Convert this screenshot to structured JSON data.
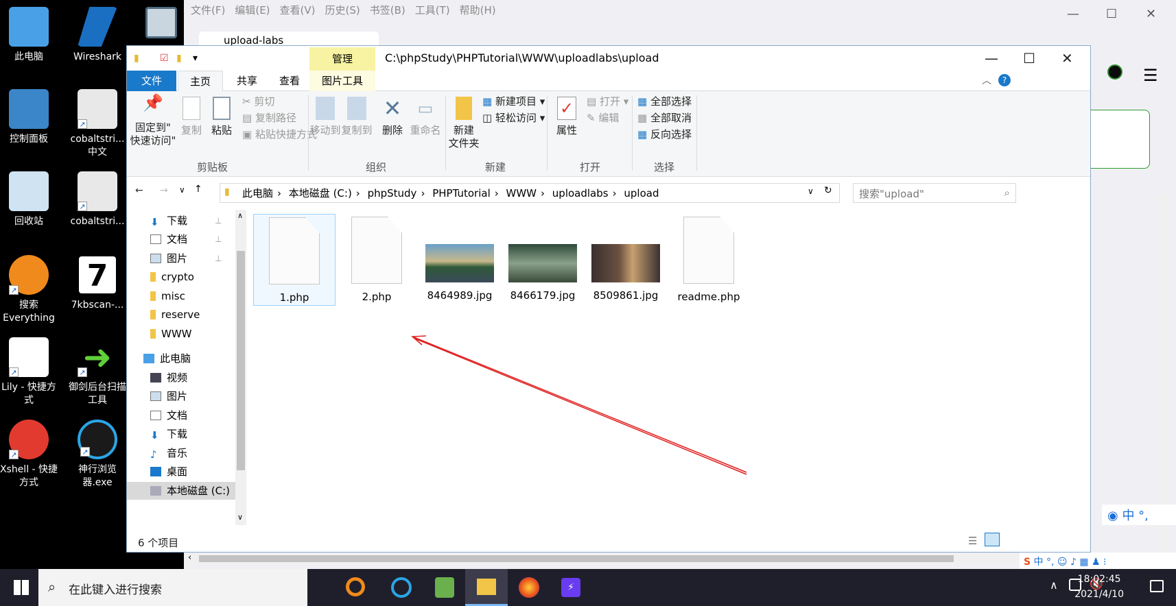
{
  "desktop": {
    "col1": [
      "此电脑",
      "控制面板",
      "回收站",
      "搜索\nEverything",
      "Lily - 快捷方式",
      "Xshell - 快捷方式"
    ],
    "col2": [
      "Wireshark",
      "cobaltstri...\n中文",
      "cobaltstri...",
      "7kbscan-...",
      "御剑后台扫描工具",
      "神行浏览器.exe"
    ]
  },
  "browser": {
    "menu": [
      "文件(F)",
      "编辑(E)",
      "查看(V)",
      "历史(S)",
      "书签(B)",
      "工具(T)",
      "帮助(H)"
    ],
    "tab_title": "upload-labs"
  },
  "explorer": {
    "manage_tab": "管理",
    "title_path": "C:\\phpStudy\\PHPTutorial\\WWW\\uploadlabs\\upload",
    "tabs": [
      "文件",
      "主页",
      "共享",
      "查看",
      "图片工具"
    ],
    "ribbon": {
      "pin": "固定到\"\n快速访问\"",
      "copy": "复制",
      "paste": "粘贴",
      "cut": "剪切",
      "copy_path": "复制路径",
      "paste_shortcut": "粘贴快捷方式",
      "move_to": "移动到",
      "copy_to": "复制到",
      "delete": "删除",
      "rename": "重命名",
      "new_folder": "新建\n文件夹",
      "new_item": "新建项目",
      "easy_access": "轻松访问",
      "properties": "属性",
      "open": "打开",
      "edit": "编辑",
      "select_all": "全部选择",
      "select_none": "全部取消",
      "invert": "反向选择",
      "groups": [
        "剪贴板",
        "组织",
        "新建",
        "打开",
        "选择"
      ]
    },
    "breadcrumb": [
      "此电脑",
      "本地磁盘 (C:)",
      "phpStudy",
      "PHPTutorial",
      "WWW",
      "uploadlabs",
      "upload"
    ],
    "search_placeholder": "搜索\"upload\"",
    "nav": [
      "下载",
      "文档",
      "图片",
      "crypto",
      "misc",
      "reserve",
      "WWW",
      "此电脑",
      "视频",
      "图片",
      "文档",
      "下载",
      "音乐",
      "桌面",
      "本地磁盘 (C:)"
    ],
    "files": [
      "1.php",
      "2.php",
      "8464989.jpg",
      "8466179.jpg",
      "8509861.jpg",
      "readme.php"
    ],
    "status": "6 个项目"
  },
  "taskbar": {
    "search": "在此键入进行搜索",
    "time": "18:02:45",
    "date": "2021/4/10",
    "ime": "中"
  },
  "colors": {
    "accent": "#1979ca",
    "manage": "#f7f3a3",
    "arrow": "#e02020"
  }
}
